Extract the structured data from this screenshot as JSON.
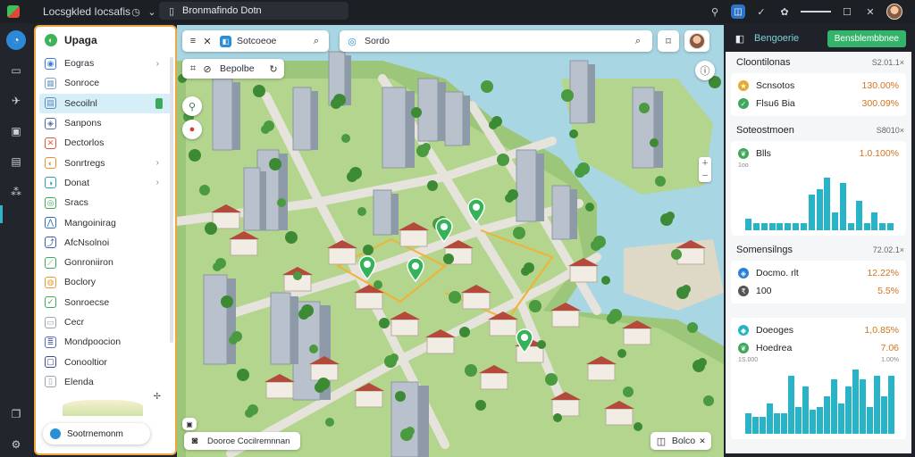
{
  "titlebar": {
    "app_name": "Locsgkled Iocsafis",
    "url": "Bronmafindo Dotn"
  },
  "sidebar": {
    "title": "Upaga",
    "items": [
      {
        "label": "Eogras",
        "icon": "map-icon",
        "color": "#3a7bd5",
        "chev": "›"
      },
      {
        "label": "Sonroce",
        "icon": "grid-icon",
        "color": "#7aa3c9",
        "chev": ""
      },
      {
        "label": "Secoilnl",
        "icon": "table-icon",
        "color": "#5a8fb8",
        "chev": "",
        "selected": true
      },
      {
        "label": "Sanpons",
        "icon": "layers-icon",
        "color": "#4d6ea8",
        "chev": ""
      },
      {
        "label": "Dectorlos",
        "icon": "tools-icon",
        "color": "#e0583a",
        "chev": ""
      },
      {
        "label": "Sonrtregs",
        "icon": "shield-icon",
        "color": "#e8902f",
        "chev": "›"
      },
      {
        "label": "Donat",
        "icon": "chat-icon",
        "color": "#2d9fb6",
        "chev": "›"
      },
      {
        "label": "Sracs",
        "icon": "target-icon",
        "color": "#3fa85a",
        "chev": ""
      },
      {
        "label": "Mangoinirag",
        "icon": "chart-icon",
        "color": "#2c6fb8",
        "chev": ""
      },
      {
        "label": "AfcNsolnoi",
        "icon": "route-icon",
        "color": "#3a5fa8",
        "chev": ""
      },
      {
        "label": "Gonroniiron",
        "icon": "trend-icon",
        "color": "#3fa85a",
        "chev": ""
      },
      {
        "label": "Boclory",
        "icon": "badge-icon",
        "color": "#e89a2f",
        "chev": ""
      },
      {
        "label": "Sonroecse",
        "icon": "check-icon",
        "color": "#3fa85a",
        "chev": ""
      },
      {
        "label": "Cecr",
        "icon": "doc-icon",
        "color": "#9aa4ae",
        "chev": ""
      },
      {
        "label": "Mondpoocion",
        "icon": "stack-icon",
        "color": "#5b6bb8",
        "chev": ""
      },
      {
        "label": "Conooltior",
        "icon": "box-icon",
        "color": "#3a4a8a",
        "chev": ""
      },
      {
        "label": "Elenda",
        "icon": "page-icon",
        "color": "#9aa4ae",
        "chev": ""
      }
    ],
    "bottom_label": "Sootrnemonm"
  },
  "map": {
    "tab_label": "Sotcoeoe",
    "search_label": "Sordo",
    "layers_label": "Bepolbe",
    "bottom_left_label": "Dooroe Cocilremnnan",
    "bottom_right_label": "Bolco"
  },
  "rpanel": {
    "head_label": "Bengoerie",
    "head_button": "Bensblembbnee",
    "sections": [
      {
        "title": "Cloontilonas",
        "meta": "S2.01.1×",
        "rows": [
          {
            "label": "Scnsotos",
            "value": "130.00%",
            "icon": "star-icon",
            "color": "#e8a92f"
          },
          {
            "label": "Flsu6 Bia",
            "value": "300.09%",
            "icon": "check-icon",
            "color": "#3fa85a"
          }
        ]
      },
      {
        "title": "Soteostmoen",
        "meta": "S8010×",
        "rows": [
          {
            "label": "Blls",
            "value": "1.0.100%",
            "icon": "leaf-icon",
            "color": "#3fa85a"
          }
        ],
        "axis_top": "1oo",
        "chart_values": [
          20,
          12,
          12,
          12,
          12,
          12,
          12,
          12,
          60,
          70,
          90,
          30,
          80,
          12,
          50,
          12,
          30,
          12,
          12
        ]
      },
      {
        "title": "Somensilngs",
        "meta": "72.02.1×",
        "rows": [
          {
            "label": "Docmo. rlt",
            "value": "12.22%",
            "icon": "shield-icon",
            "color": "#2a7fd6"
          },
          {
            "label": "100",
            "value": "5.5%",
            "icon": "rupee-icon",
            "color": "#555"
          }
        ]
      },
      {
        "title": "",
        "meta": "",
        "rows": [
          {
            "label": "Doeoges",
            "value": "1,0.85%",
            "icon": "pin-icon",
            "color": "#29b3c6"
          },
          {
            "label": "Hoedrea",
            "value": "7.06",
            "icon": "leaf-icon",
            "color": "#3fa85a"
          }
        ],
        "axis_top": "1S.000",
        "axis_right": "1.00%",
        "chart_values": [
          30,
          25,
          25,
          45,
          30,
          30,
          85,
          40,
          70,
          35,
          40,
          55,
          80,
          45,
          70,
          95,
          80,
          40,
          85,
          55,
          85
        ]
      }
    ]
  }
}
